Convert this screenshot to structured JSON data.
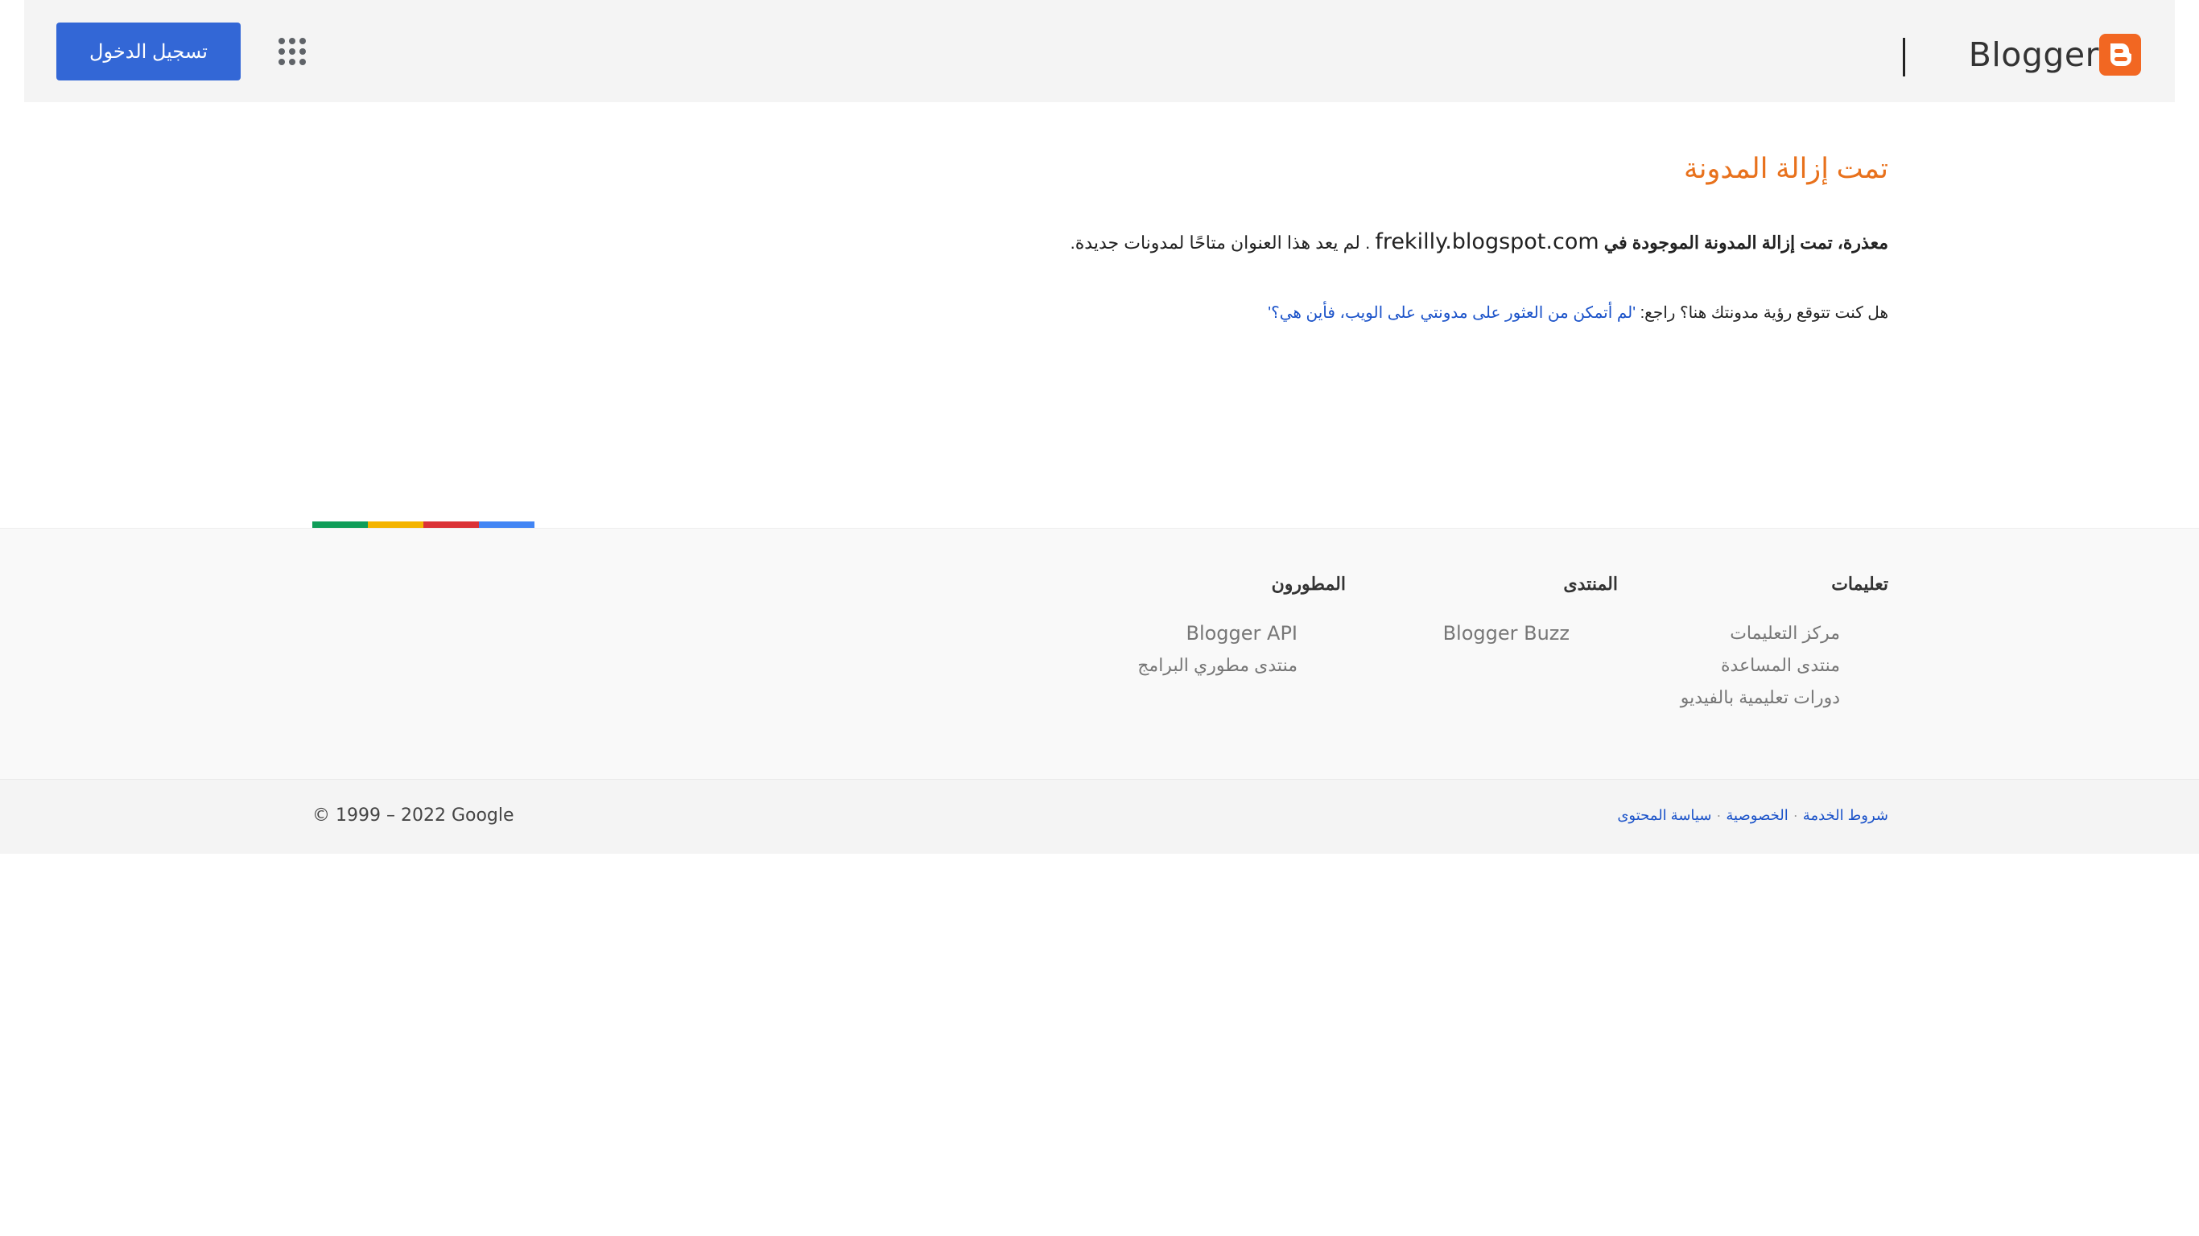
{
  "header": {
    "logo_text": "Blogger",
    "signin_label": "تسجيل الدخول",
    "apps_icon": "apps-grid-icon"
  },
  "main": {
    "title": "تمت إزالة المدونة",
    "message_bold": "معذرة، تمت إزالة المدونة الموجودة في",
    "blog_url": "frekilly.blogspot.com",
    "message_rest": ". لم يعد هذا العنوان متاحًا لمدونات جديدة.",
    "hint_prefix": "هل كنت تتوقع رؤية مدونتك هنا؟ راجع:",
    "hint_link": "'لم أتمكن من العثور على مدونتي على الويب، فأين هي؟'"
  },
  "colorbar": [
    "#4285f4",
    "#db3236",
    "#f4b400",
    "#0f9d58"
  ],
  "footer": {
    "columns": [
      {
        "title": "تعليمات",
        "links": [
          "مركز التعليمات",
          "منتدى المساعدة",
          "دورات تعليمية بالفيديو"
        ]
      },
      {
        "title": "المنتدى",
        "links": [
          "Blogger Buzz"
        ]
      },
      {
        "title": "المطورون",
        "links": [
          "Blogger API",
          "منتدى مطوري البرامج"
        ]
      }
    ],
    "legal": [
      "شروط الخدمة",
      "الخصوصية",
      "سياسة المحتوى"
    ],
    "copyright": "© 1999 – 2022 Google"
  },
  "colors": {
    "accent": "#e8711c",
    "primary_button": "#3367d6",
    "link": "#1a52c9",
    "logo": "#f26722"
  }
}
